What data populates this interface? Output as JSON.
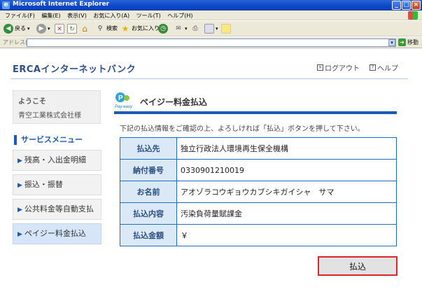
{
  "browser": {
    "window_title": "Microsoft Internet Explorer",
    "menu": [
      "ファイル(F)",
      "編集(E)",
      "表示(V)",
      "お気に入り(A)",
      "ツール(T)",
      "ヘルプ(H)"
    ],
    "toolbar": {
      "back": "戻る",
      "search": "検索",
      "favorites": "お気に入り"
    },
    "address_label": "アドレス(D)",
    "address_value": "",
    "go_label": "移動"
  },
  "header": {
    "brand": "ERCAインターネットバンク",
    "logout": "ログアウト",
    "help": "ヘルプ"
  },
  "sidebar": {
    "welcome": "ようこそ",
    "company": "青空工業株式会社様",
    "menu_title": "サービスメニュー",
    "items": [
      {
        "label": "残高・入出金明細"
      },
      {
        "label": "振込・振替"
      },
      {
        "label": "公共料金等自動支払"
      },
      {
        "label": "ペイジー料金払込"
      }
    ]
  },
  "main": {
    "logo_text": "Pay-easy",
    "title": "ペイジー料金払込",
    "instruction": "下記の払込情報をご確認の上、よろしければ「払込」ボタンを押して下さい。",
    "rows": [
      {
        "label": "払込先",
        "value": "独立行政法人環境再生保全機構"
      },
      {
        "label": "納付番号",
        "value": "0330901210019"
      },
      {
        "label": "お名前",
        "value": "アオゾラコウギョウカブシキガイシャ　サマ"
      },
      {
        "label": "払込内容",
        "value": "汚染負荷量賦課金"
      },
      {
        "label": "払込金額",
        "value": "￥"
      }
    ],
    "submit_label": "払込"
  }
}
